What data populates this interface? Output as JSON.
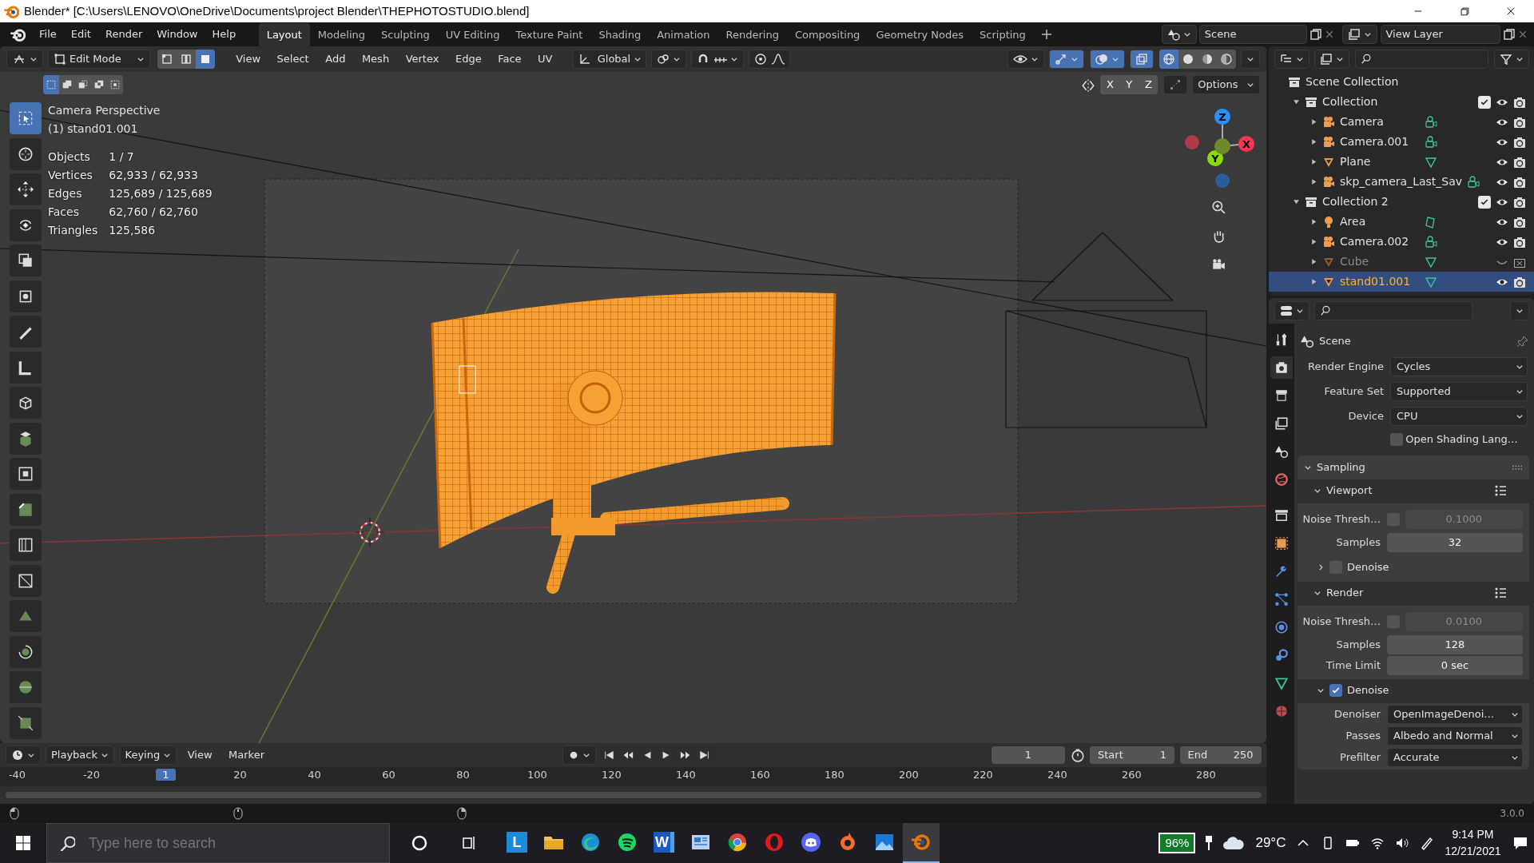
{
  "window": {
    "title": "Blender* [C:\\Users\\LENOVO\\OneDrive\\Documents\\project Blender\\THEPHOTOSTUDIO.blend]"
  },
  "menu": [
    "File",
    "Edit",
    "Render",
    "Window",
    "Help"
  ],
  "workspaces": [
    {
      "label": "Layout",
      "selected": true
    },
    {
      "label": "Modeling",
      "selected": false
    },
    {
      "label": "Sculpting",
      "selected": false
    },
    {
      "label": "UV Editing",
      "selected": false
    },
    {
      "label": "Texture Paint",
      "selected": false
    },
    {
      "label": "Shading",
      "selected": false
    },
    {
      "label": "Animation",
      "selected": false
    },
    {
      "label": "Rendering",
      "selected": false
    },
    {
      "label": "Compositing",
      "selected": false
    },
    {
      "label": "Geometry Nodes",
      "selected": false
    },
    {
      "label": "Scripting",
      "selected": false
    }
  ],
  "scene": "Scene",
  "view_layer": "View Layer",
  "viewport": {
    "mode": "Edit Mode",
    "select_modes": [
      {
        "kind": "vertex",
        "selected": false
      },
      {
        "kind": "edge",
        "selected": false
      },
      {
        "kind": "face",
        "selected": true
      }
    ],
    "menus": [
      "View",
      "Select",
      "Add",
      "Mesh",
      "Vertex",
      "Edge",
      "Face",
      "UV"
    ],
    "orientation": "Global",
    "toggles": [
      {
        "kind": "gizmo",
        "on": true
      },
      {
        "kind": "overlay",
        "on": true
      },
      {
        "kind": "xray",
        "on": true
      }
    ],
    "shading": [
      {
        "kind": "wireframe",
        "selected": true
      },
      {
        "kind": "solid",
        "selected": false
      },
      {
        "kind": "material",
        "selected": false
      },
      {
        "kind": "rendered",
        "selected": false
      }
    ],
    "axes": [
      "X",
      "Y",
      "Z"
    ],
    "options": "Options",
    "view_name": "Camera Perspective",
    "object": "(1) stand01.001",
    "stats": [
      {
        "label": "Objects",
        "value": "1 / 7"
      },
      {
        "label": "Vertices",
        "value": "62,933 / 62,933"
      },
      {
        "label": "Edges",
        "value": "125,689 / 125,689"
      },
      {
        "label": "Faces",
        "value": "62,760 / 62,760"
      },
      {
        "label": "Triangles",
        "value": "125,586"
      }
    ],
    "gizmo": [
      "Z",
      "X",
      "Y"
    ],
    "tools": [
      {
        "kind": "select",
        "selected": true
      },
      {
        "kind": "cursor",
        "selected": false
      },
      {
        "kind": "move",
        "selected": false
      },
      {
        "kind": "rotate",
        "selected": false
      },
      {
        "kind": "scale",
        "selected": false
      },
      {
        "kind": "transform",
        "selected": false
      },
      {
        "kind": "annotate",
        "selected": false
      },
      {
        "kind": "measure",
        "selected": false
      },
      {
        "kind": "add-cube",
        "selected": false
      },
      {
        "kind": "extrude",
        "selected": false
      },
      {
        "kind": "inset",
        "selected": false
      },
      {
        "kind": "bevel",
        "selected": false
      },
      {
        "kind": "loop-cut",
        "selected": false
      },
      {
        "kind": "knife",
        "selected": false
      },
      {
        "kind": "poly-build",
        "selected": false
      },
      {
        "kind": "spin",
        "selected": false
      },
      {
        "kind": "smooth",
        "selected": false
      },
      {
        "kind": "shrink",
        "selected": false
      }
    ]
  },
  "outliner": {
    "root": "Scene Collection",
    "items": [
      {
        "name": "Collection",
        "kind": "collection",
        "checked": true,
        "expanded": true,
        "selected": false,
        "children": [
          {
            "name": "Camera",
            "kind": "camera",
            "hidden": false,
            "selected": false
          },
          {
            "name": "Camera.001",
            "kind": "camera",
            "hidden": false,
            "selected": false
          },
          {
            "name": "Plane",
            "kind": "mesh",
            "hidden": false,
            "selected": false
          },
          {
            "name": "skp_camera_Last_Sav",
            "kind": "camera",
            "hidden": false,
            "selected": false
          }
        ]
      },
      {
        "name": "Collection 2",
        "kind": "collection",
        "checked": true,
        "expanded": true,
        "selected": false,
        "children": [
          {
            "name": "Area",
            "kind": "light",
            "hidden": false,
            "selected": false
          },
          {
            "name": "Camera.002",
            "kind": "camera",
            "hidden": false,
            "selected": false
          },
          {
            "name": "Cube",
            "kind": "mesh",
            "hidden": true,
            "selected": false
          },
          {
            "name": "stand01.001",
            "kind": "mesh",
            "hidden": false,
            "selected": true
          }
        ]
      }
    ]
  },
  "properties": {
    "tabs": [
      {
        "kind": "tool",
        "selected": false
      },
      {
        "kind": "render",
        "selected": true
      },
      {
        "kind": "output",
        "selected": false
      },
      {
        "kind": "view-layer",
        "selected": false
      },
      {
        "kind": "scene",
        "selected": false
      },
      {
        "kind": "world",
        "selected": false
      },
      {
        "kind": "collection",
        "selected": false
      },
      {
        "kind": "object",
        "selected": false
      },
      {
        "kind": "modifier",
        "selected": false
      },
      {
        "kind": "particles",
        "selected": false
      },
      {
        "kind": "physics",
        "selected": false
      },
      {
        "kind": "constraints",
        "selected": false
      },
      {
        "kind": "data",
        "selected": false
      },
      {
        "kind": "material",
        "selected": false
      }
    ],
    "title": "Scene",
    "fields": [
      {
        "label": "Render Engine",
        "value": "Cycles"
      },
      {
        "label": "Feature Set",
        "value": "Supported"
      },
      {
        "label": "Device",
        "value": "CPU"
      }
    ],
    "osl": {
      "label": "Open Shading Lang…",
      "checked": false
    },
    "panel": {
      "title": "Sampling",
      "expanded": true,
      "sections": [
        {
          "title": "Viewport",
          "expanded": true,
          "rows": [
            {
              "kind": "toggle-number",
              "label": "Noise Thresh…",
              "checked": false,
              "value": "0.1000"
            },
            {
              "kind": "number",
              "label": "Samples",
              "value": "32"
            },
            {
              "kind": "subpanel",
              "label": "Denoise",
              "checked": false,
              "expanded": false
            }
          ]
        },
        {
          "title": "Render",
          "expanded": true,
          "rows": [
            {
              "kind": "toggle-number",
              "label": "Noise Thresh…",
              "checked": false,
              "value": "0.0100"
            },
            {
              "kind": "number",
              "label": "Samples",
              "value": "128"
            },
            {
              "kind": "number",
              "label": "Time Limit",
              "value": "0 sec"
            },
            {
              "kind": "subpanel",
              "label": "Denoise",
              "checked": true,
              "expanded": true
            },
            {
              "kind": "dropdown",
              "label": "Denoiser",
              "value": "OpenImageDenoi…"
            },
            {
              "kind": "dropdown",
              "label": "Passes",
              "value": "Albedo and Normal"
            },
            {
              "kind": "dropdown",
              "label": "Prefilter",
              "value": "Accurate"
            }
          ]
        }
      ]
    }
  },
  "timeline": {
    "menus": [
      "Playback",
      "Keying",
      "View",
      "Marker"
    ],
    "current_frame": "1",
    "start_label": "Start",
    "start": "1",
    "end_label": "End",
    "end": "250",
    "ruler": [
      {
        "label": "-40",
        "selected": false
      },
      {
        "label": "-20",
        "selected": false
      },
      {
        "label": "1",
        "selected": true
      },
      {
        "label": "20",
        "selected": false
      },
      {
        "label": "40",
        "selected": false
      },
      {
        "label": "60",
        "selected": false
      },
      {
        "label": "80",
        "selected": false
      },
      {
        "label": "100",
        "selected": false
      },
      {
        "label": "120",
        "selected": false
      },
      {
        "label": "140",
        "selected": false
      },
      {
        "label": "160",
        "selected": false
      },
      {
        "label": "180",
        "selected": false
      },
      {
        "label": "200",
        "selected": false
      },
      {
        "label": "220",
        "selected": false
      },
      {
        "label": "240",
        "selected": false
      },
      {
        "label": "260",
        "selected": false
      },
      {
        "label": "280",
        "selected": false
      }
    ]
  },
  "status": {
    "version": "3.0.0"
  },
  "taskbar": {
    "search_placeholder": "Type here to search",
    "apps": [
      {
        "kind": "tile",
        "label": "L",
        "active": false
      },
      {
        "kind": "folder",
        "active": false
      },
      {
        "kind": "edge",
        "active": false
      },
      {
        "kind": "spotify",
        "active": false
      },
      {
        "kind": "word",
        "label": "W",
        "active": false
      },
      {
        "kind": "news",
        "active": false
      },
      {
        "kind": "chrome",
        "active": false
      },
      {
        "kind": "opera",
        "active": false
      },
      {
        "kind": "discord",
        "active": false
      },
      {
        "kind": "origin",
        "active": false
      },
      {
        "kind": "photos",
        "active": false
      },
      {
        "kind": "blender",
        "active": true
      }
    ],
    "battery": "96%",
    "temperature": "29°C",
    "time": "9:14 PM",
    "date": "12/21/2021"
  }
}
